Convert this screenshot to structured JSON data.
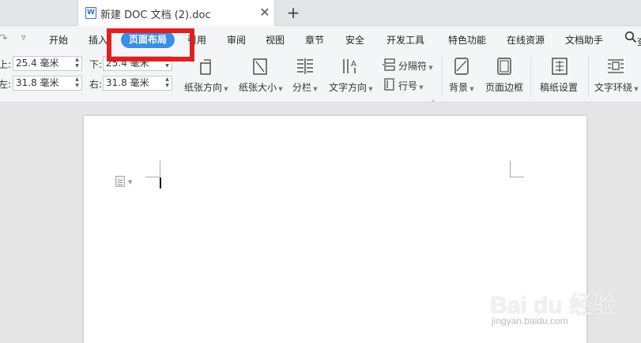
{
  "tabbar": {
    "doc_icon": "W",
    "doc_title": "新建 DOC 文档 (2).doc",
    "close_glyph": "✕",
    "new_tab_glyph": "+"
  },
  "menu": {
    "items": [
      {
        "label": "开始"
      },
      {
        "label": "插入"
      },
      {
        "label": "页面布局",
        "active": true
      },
      {
        "label": "引用"
      },
      {
        "label": "审阅"
      },
      {
        "label": "视图"
      },
      {
        "label": "章节"
      },
      {
        "label": "安全"
      },
      {
        "label": "开发工具"
      },
      {
        "label": "特色功能"
      },
      {
        "label": "在线资源"
      },
      {
        "label": "文档助手"
      }
    ],
    "search_tail": "查"
  },
  "margins": {
    "top_label": "上:",
    "top_value": "25.4 毫米",
    "bottom_label": "下:",
    "bottom_value": "25.4 毫米",
    "left_label": "左:",
    "left_value": "31.8 毫米",
    "right_label": "右:",
    "right_value": "31.8 毫米"
  },
  "ribbon": {
    "orientation": "纸张方向",
    "size": "纸张大小",
    "columns": "分栏",
    "text_direction": "文字方向",
    "separator": "分隔符",
    "line_number": "行号",
    "background": "背景",
    "page_border": "页面边框",
    "manuscript": "稿纸设置",
    "text_wrap": "文字环绕"
  },
  "watermark": {
    "logo": "Bai du 经验",
    "url": "jingyan.baidu.com"
  },
  "colors": {
    "accent": "#3a8ee6",
    "highlight": "#e02020",
    "doc_icon": "#2f6fd6"
  }
}
